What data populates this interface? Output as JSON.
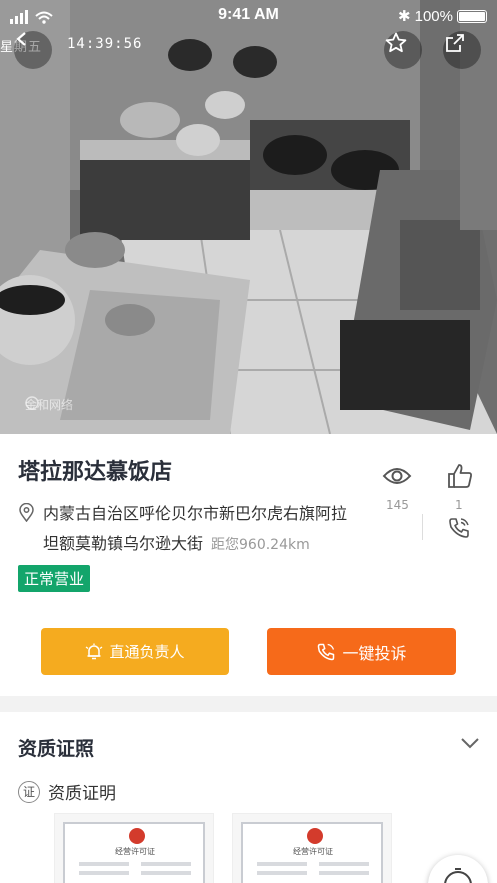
{
  "status_bar": {
    "time": "9:41 AM",
    "battery": "100%"
  },
  "camera": {
    "overlay_prefix": "星期五",
    "timestamp": "14:39:56",
    "watermark": "金和网络"
  },
  "shop": {
    "name": "塔拉那达慕饭店",
    "address_line1": "内蒙古自治区呼伦贝尔市新巴尔虎右旗阿拉",
    "address_line2": "坦额莫勒镇乌尔逊大街",
    "distance": "距您960.24km",
    "status": "正常营业",
    "views": "145",
    "likes": "1"
  },
  "actions": {
    "direct_label": "直通负责人",
    "complain_label": "一键投诉"
  },
  "quals": {
    "title": "资质证照",
    "cert_badge": "证",
    "cert_label": "资质证明",
    "licenses": [
      {
        "title": "经营许可证"
      },
      {
        "title": "经营许可证"
      }
    ]
  },
  "colors": {
    "accent_green": "#13a56b",
    "button_yellow": "#f5ab1f",
    "button_orange": "#f66a1a"
  },
  "icons": [
    "back-icon",
    "star-icon",
    "share-icon",
    "location-pin-icon",
    "eye-icon",
    "thumbs-up-icon",
    "phone-icon",
    "bell-icon",
    "chevron-down-icon"
  ]
}
